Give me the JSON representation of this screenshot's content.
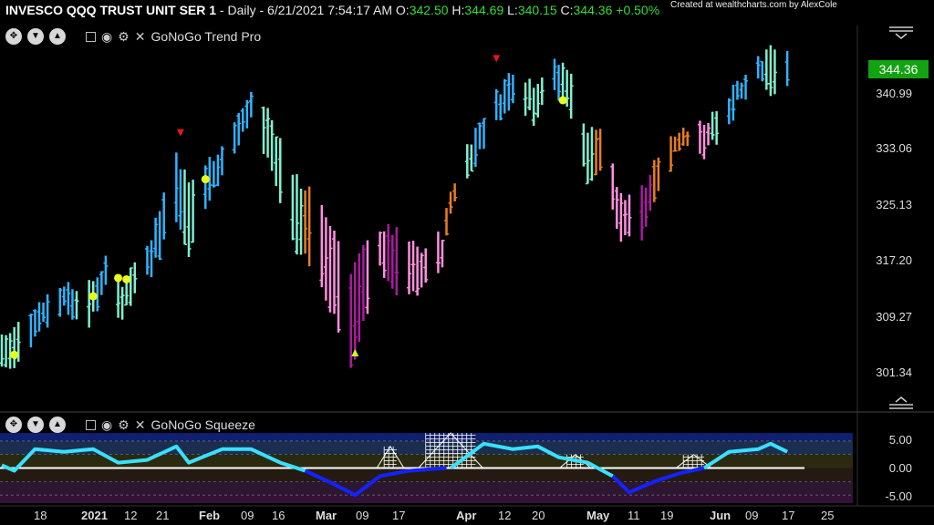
{
  "header": {
    "symbol": "INVESCO QQQ TRUST UNIT SER 1",
    "info": " - Daily - 6/21/2021 7:54:17 AM O:",
    "open": "342.50",
    "h_label": "H:",
    "high": "344.69",
    "l_label": "L:",
    "low": "340.15",
    "c_label": "C:",
    "close": "344.36",
    "change": "+0.50%",
    "credit": "Created at wealthcharts.com by AlexCole"
  },
  "panels": {
    "trend": {
      "name": "GoNoGo Trend Pro"
    },
    "squeeze": {
      "name": "GoNoGo Squeeze"
    }
  },
  "price_label": "344.36",
  "colors": {
    "go_strong": "#2fb4ff",
    "go_weak": "#7ff0d0",
    "nogo_weak": "#ff8fe0",
    "nogo_strong": "#aa1ba0",
    "amber": "#e87d22",
    "signal_dot": "#e8ff1a",
    "price_box": "#12a312"
  },
  "chart_data": [
    {
      "type": "bar",
      "title": "GoNoGo Trend Pro",
      "subtype": "ohlc",
      "y_ticks": [
        "344.36",
        "340.99",
        "333.06",
        "325.13",
        "317.20",
        "309.27",
        "301.34"
      ],
      "ylim": [
        295,
        348
      ],
      "x_ticks": [
        "18",
        "2021",
        "12",
        "21",
        "Feb",
        "09",
        "16",
        "Mar",
        "09",
        "17",
        "Apr",
        "12",
        "20",
        "May",
        "11",
        "19",
        "Jun",
        "09",
        "17",
        "25"
      ],
      "x_range": [
        "2020-12-14",
        "2021-06-28"
      ],
      "bars_approx": [
        {
          "date": "2020-12-16",
          "high": 304.2,
          "low": 299.5,
          "color": "go_weak"
        },
        {
          "date": "2020-12-22",
          "high": 308.5,
          "low": 304.0,
          "color": "go_strong"
        },
        {
          "date": "2020-12-29",
          "high": 311.5,
          "low": 307.5,
          "color": "go_strong"
        },
        {
          "date": "2021-01-04",
          "high": 311.0,
          "low": 305.5,
          "color": "go_weak"
        },
        {
          "date": "2021-01-08",
          "high": 314.5,
          "low": 310.5,
          "color": "go_strong"
        },
        {
          "date": "2021-01-12",
          "high": 311.5,
          "low": 306.5,
          "color": "go_weak"
        },
        {
          "date": "2021-01-19",
          "high": 318.5,
          "low": 313.0,
          "color": "go_strong"
        },
        {
          "date": "2021-01-25",
          "high": 330.0,
          "low": 321.0,
          "color": "go_strong"
        },
        {
          "date": "2021-01-28",
          "high": 325.5,
          "low": 316.0,
          "color": "go_weak"
        },
        {
          "date": "2021-02-05",
          "high": 331.0,
          "low": 327.0,
          "color": "go_strong"
        },
        {
          "date": "2021-02-12",
          "high": 338.5,
          "low": 334.0,
          "color": "go_strong"
        },
        {
          "date": "2021-02-16",
          "high": 336.0,
          "low": 329.5,
          "color": "go_weak"
        },
        {
          "date": "2021-02-23",
          "high": 326.0,
          "low": 315.5,
          "color": "go_weak"
        },
        {
          "date": "2021-02-26",
          "high": 324.5,
          "low": 314.5,
          "color": "amber"
        },
        {
          "date": "2021-03-04",
          "high": 319.0,
          "low": 307.0,
          "color": "nogo_weak"
        },
        {
          "date": "2021-03-08",
          "high": 313.5,
          "low": 299.0,
          "color": "nogo_strong"
        },
        {
          "date": "2021-03-15",
          "high": 319.5,
          "low": 313.5,
          "color": "nogo_weak"
        },
        {
          "date": "2021-03-19",
          "high": 318.5,
          "low": 309.5,
          "color": "nogo_strong"
        },
        {
          "date": "2021-03-25",
          "high": 316.0,
          "low": 310.0,
          "color": "nogo_weak"
        },
        {
          "date": "2021-03-30",
          "high": 318.5,
          "low": 314.0,
          "color": "nogo_weak"
        },
        {
          "date": "2021-04-01",
          "high": 324.5,
          "low": 322.0,
          "color": "amber"
        },
        {
          "date": "2021-04-05",
          "high": 331.0,
          "low": 326.0,
          "color": "go_weak"
        },
        {
          "date": "2021-04-09",
          "high": 335.5,
          "low": 331.5,
          "color": "go_strong"
        },
        {
          "date": "2021-04-16",
          "high": 342.0,
          "low": 337.5,
          "color": "go_strong"
        },
        {
          "date": "2021-04-21",
          "high": 340.0,
          "low": 334.5,
          "color": "go_weak"
        },
        {
          "date": "2021-04-26",
          "high": 342.5,
          "low": 338.5,
          "color": "go_strong"
        },
        {
          "date": "2021-04-29",
          "high": 342.5,
          "low": 336.5,
          "color": "go_weak"
        },
        {
          "date": "2021-05-04",
          "high": 333.0,
          "low": 326.0,
          "color": "go_weak"
        },
        {
          "date": "2021-05-07",
          "high": 333.5,
          "low": 327.0,
          "color": "amber"
        },
        {
          "date": "2021-05-12",
          "high": 323.5,
          "low": 317.5,
          "color": "nogo_weak"
        },
        {
          "date": "2021-05-18",
          "high": 326.0,
          "low": 318.5,
          "color": "nogo_strong"
        },
        {
          "date": "2021-05-21",
          "high": 330.0,
          "low": 325.5,
          "color": "amber"
        },
        {
          "date": "2021-05-27",
          "high": 334.0,
          "low": 331.0,
          "color": "amber"
        },
        {
          "date": "2021-06-01",
          "high": 333.5,
          "low": 330.0,
          "color": "nogo_weak"
        },
        {
          "date": "2021-06-04",
          "high": 335.5,
          "low": 331.5,
          "color": "go_weak"
        },
        {
          "date": "2021-06-09",
          "high": 339.5,
          "low": 336.5,
          "color": "go_strong"
        },
        {
          "date": "2021-06-14",
          "high": 343.0,
          "low": 340.0,
          "color": "go_strong"
        },
        {
          "date": "2021-06-17",
          "high": 345.5,
          "low": 338.5,
          "color": "go_weak"
        },
        {
          "date": "2021-06-21",
          "high": 344.7,
          "low": 340.2,
          "color": "go_strong"
        }
      ],
      "markers": [
        {
          "type": "go-dot",
          "date": "2020-12-17",
          "y": 301.3
        },
        {
          "type": "go-dot",
          "date": "2021-01-05",
          "y": 309.6
        },
        {
          "type": "go-dot",
          "date": "2021-01-11",
          "y": 312.2
        },
        {
          "type": "go-dot",
          "date": "2021-01-13",
          "y": 312.0
        },
        {
          "type": "go-dot",
          "date": "2021-02-01",
          "y": 326.2
        },
        {
          "type": "go-dot",
          "date": "2021-04-28",
          "y": 337.4
        },
        {
          "type": "down-triangle",
          "date": "2021-01-26",
          "y": 332.8
        },
        {
          "type": "down-triangle",
          "date": "2021-04-12",
          "y": 343.3
        },
        {
          "type": "up-triangle",
          "date": "2021-03-09",
          "y": 301.6
        }
      ]
    },
    {
      "type": "line",
      "title": "GoNoGo Squeeze",
      "y_ticks": [
        "5.00",
        "0.00",
        "-5.00"
      ],
      "ylim": [
        -6.5,
        6.5
      ],
      "series": [
        {
          "color": "#39e0ff",
          "points": [
            [
              "2020-12-14",
              0.5
            ],
            [
              "2020-12-17",
              -0.5
            ],
            [
              "2020-12-22",
              3.5
            ],
            [
              "2020-12-29",
              3.0
            ],
            [
              "2021-01-05",
              3.5
            ],
            [
              "2021-01-11",
              1.0
            ],
            [
              "2021-01-18",
              1.5
            ],
            [
              "2021-01-25",
              4.0
            ],
            [
              "2021-01-28",
              1.0
            ],
            [
              "2021-02-05",
              3.5
            ],
            [
              "2021-02-12",
              3.5
            ],
            [
              "2021-02-19",
              1.0
            ],
            [
              "2021-02-25",
              -0.5
            ]
          ]
        },
        {
          "color": "#1422ff",
          "points": [
            [
              "2021-02-25",
              -0.5
            ],
            [
              "2021-03-04",
              -3.0
            ],
            [
              "2021-03-09",
              -5.0
            ],
            [
              "2021-03-15",
              -1.5
            ],
            [
              "2021-03-22",
              -0.5
            ],
            [
              "2021-03-31",
              0.0
            ]
          ]
        },
        {
          "color": "#39e0ff",
          "points": [
            [
              "2021-04-01",
              0.0
            ],
            [
              "2021-04-09",
              4.5
            ],
            [
              "2021-04-16",
              3.5
            ],
            [
              "2021-04-22",
              4.0
            ],
            [
              "2021-04-27",
              2.0
            ],
            [
              "2021-05-04",
              1.0
            ],
            [
              "2021-05-10",
              -1.5
            ]
          ]
        },
        {
          "color": "#1422ff",
          "points": [
            [
              "2021-05-10",
              -1.5
            ],
            [
              "2021-05-14",
              -4.5
            ],
            [
              "2021-05-20",
              -2.5
            ],
            [
              "2021-05-26",
              -1.0
            ],
            [
              "2021-06-01",
              0.0
            ]
          ]
        },
        {
          "color": "#39e0ff",
          "points": [
            [
              "2021-06-01",
              0.0
            ],
            [
              "2021-06-07",
              3.0
            ],
            [
              "2021-06-14",
              3.5
            ],
            [
              "2021-06-17",
              4.5
            ],
            [
              "2021-06-21",
              3.0
            ]
          ]
        }
      ],
      "squeeze_grid": [
        {
          "start": "2021-03-16",
          "end": "2021-03-19",
          "level": 4.0
        },
        {
          "start": "2021-03-26",
          "end": "2021-04-07",
          "level": 6.5
        },
        {
          "start": "2021-04-29",
          "end": "2021-05-03",
          "level": 2.5
        },
        {
          "start": "2021-05-27",
          "end": "2021-06-01",
          "level": 2.5
        }
      ]
    }
  ]
}
